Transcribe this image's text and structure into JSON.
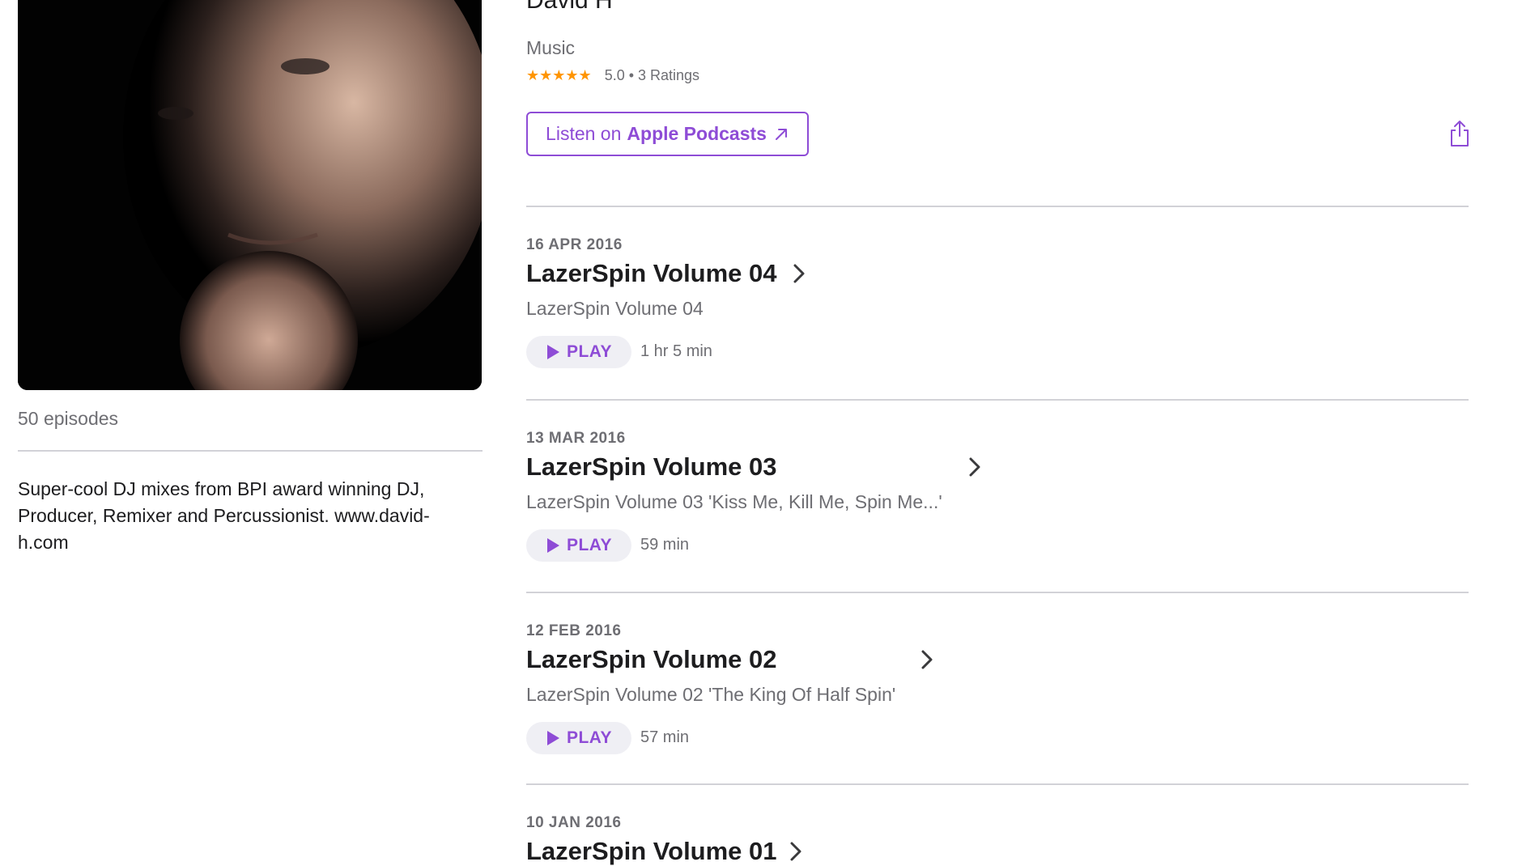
{
  "header": {
    "author": "David H",
    "category": "Music",
    "stars": "★★★★★",
    "rating": "5.0 • 3 Ratings",
    "listen_prefix": "Listen on",
    "listen_brand": "Apple Podcasts"
  },
  "sidebar": {
    "episode_count": "50 episodes",
    "description": "Super-cool DJ mixes from BPI award winning DJ, Producer, Remixer and Percussionist. www.david-h.com"
  },
  "episodes": [
    {
      "date": "16 APR 2016",
      "title": "LazerSpin Volume 04",
      "subtitle": "LazerSpin Volume 04",
      "play_label": "PLAY",
      "duration": "1 hr 5 min"
    },
    {
      "date": "13 MAR 2016",
      "title": "LazerSpin Volume 03",
      "subtitle": "LazerSpin Volume 03 'Kiss Me, Kill Me, Spin Me...'",
      "play_label": "PLAY",
      "duration": "59 min"
    },
    {
      "date": "12 FEB 2016",
      "title": "LazerSpin Volume 02",
      "subtitle": "LazerSpin Volume 02 'The King Of Half Spin'",
      "play_label": "PLAY",
      "duration": "57 min"
    },
    {
      "date": "10 JAN 2016",
      "title": "LazerSpin Volume 01"
    }
  ],
  "colors": {
    "accent": "#8e4cd6",
    "star": "#ff9500",
    "secondary_text": "#6e6e73",
    "divider": "#d2d2d7",
    "play_bg": "#efeff4"
  }
}
